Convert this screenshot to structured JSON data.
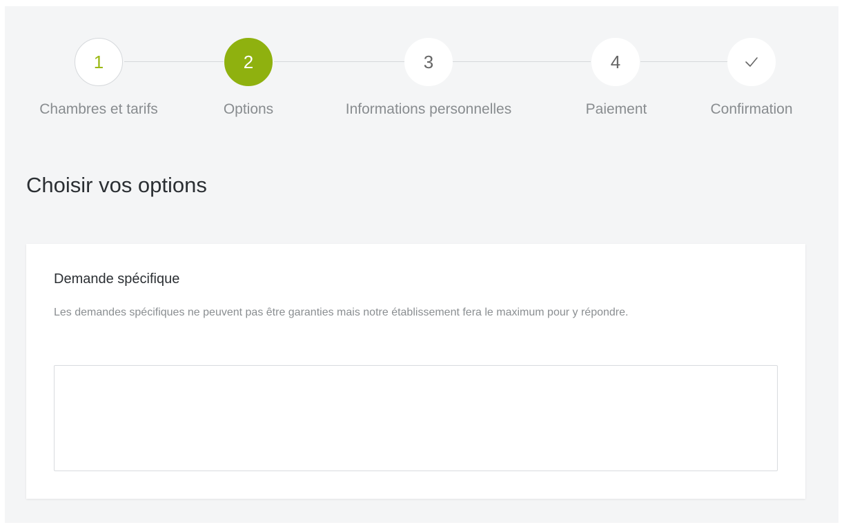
{
  "stepper": {
    "steps": [
      {
        "number": "1",
        "label": "Chambres et tarifs",
        "state": "done"
      },
      {
        "number": "2",
        "label": "Options",
        "state": "active"
      },
      {
        "number": "3",
        "label": "Informations personnelles",
        "state": "pending"
      },
      {
        "number": "4",
        "label": "Paiement",
        "state": "pending"
      },
      {
        "number": "",
        "label": "Confirmation",
        "state": "pending",
        "icon": "check-icon"
      }
    ]
  },
  "page": {
    "title": "Choisir vos options"
  },
  "special_request": {
    "heading": "Demande spécifique",
    "help_text": "Les demandes spécifiques ne peuvent pas être garanties mais notre établissement fera le maximum pour y répondre.",
    "value": "",
    "placeholder": ""
  },
  "colors": {
    "accent": "#8fb10f",
    "done_number": "#9bb814",
    "background": "#f4f5f6",
    "card": "#ffffff"
  }
}
